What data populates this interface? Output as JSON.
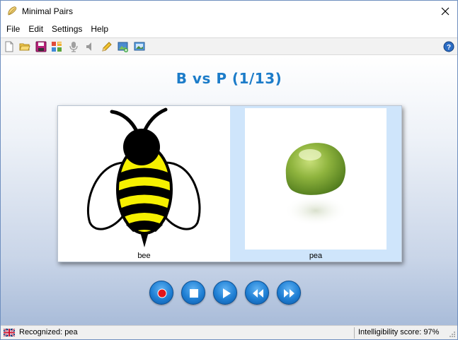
{
  "window": {
    "title": "Minimal Pairs"
  },
  "menu": {
    "items": [
      "File",
      "Edit",
      "Settings",
      "Help"
    ]
  },
  "toolbar": {
    "icons": [
      "new-icon",
      "open-icon",
      "save-icon",
      "grid-icon",
      "microphone-icon",
      "speaker-icon",
      "pencil-icon",
      "add-image-icon",
      "picture-icon",
      "help-icon"
    ]
  },
  "main": {
    "heading": "B vs P (1/13)",
    "cards": [
      {
        "label": "bee",
        "image": "bee-icon",
        "selected": false
      },
      {
        "label": "pea",
        "image": "pea-icon",
        "selected": true
      }
    ],
    "selected_card_color": "#cfe5fb",
    "heading_color": "#1c7cc9"
  },
  "controls": {
    "buttons": [
      "record-button",
      "stop-button",
      "play-button",
      "rewind-button",
      "fast-forward-button"
    ],
    "accent_color": "#1f7fd4"
  },
  "status": {
    "recognized": "Recognized: pea",
    "score": "Intelligibility score: 97%",
    "language_icon": "uk-flag-icon"
  }
}
